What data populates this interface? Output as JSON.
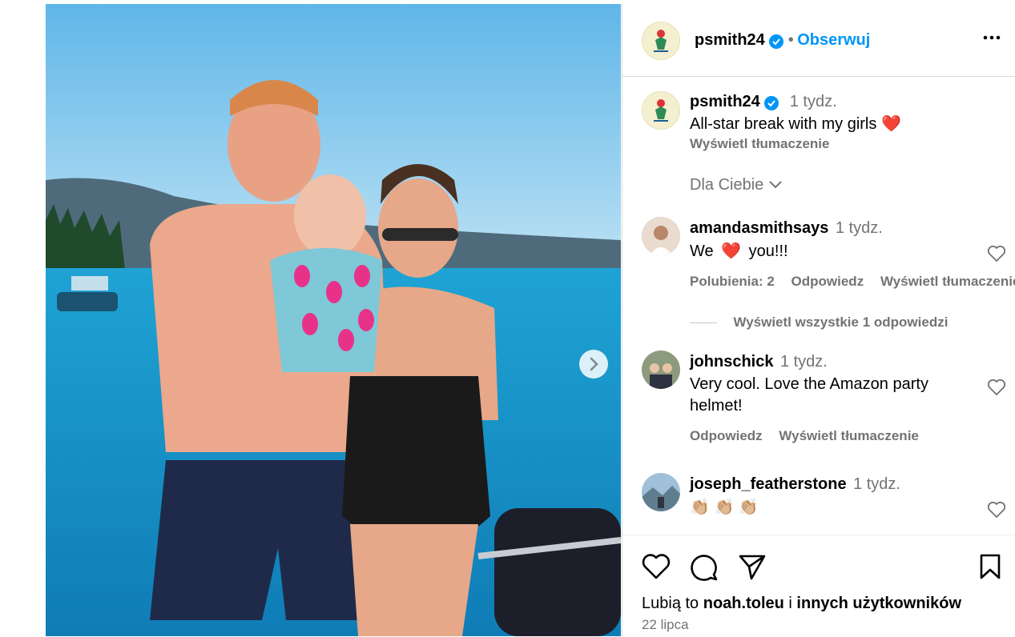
{
  "post": {
    "author": "psmith24",
    "follow_label": "Obserwuj",
    "separator": "•",
    "caption_time": "1 tydz.",
    "caption": "All-star break with my girls",
    "caption_emoji": "❤️",
    "translate_label": "Wyświetl tłumaczenie",
    "sort_label": "Dla Ciebie"
  },
  "comments": [
    {
      "user": "amandasmithsays",
      "time": "1 tydz.",
      "text_before": "We",
      "emoji": "❤️",
      "text_after": "you!!!",
      "likes_label": "Polubienia: 2",
      "reply_label": "Odpowiedz",
      "translate_label": "Wyświetl tłumaczenie",
      "view_replies": "Wyświetl wszystkie 1 odpowiedzi"
    },
    {
      "user": "johnschick",
      "time": "1 tydz.",
      "text": "Very cool. Love the Amazon party helmet!",
      "reply_label": "Odpowiedz",
      "translate_label": "Wyświetl tłumaczenie"
    },
    {
      "user": "joseph_featherstone",
      "time": "1 tydz.",
      "text": "👏🏼 👏🏼 👏🏼"
    }
  ],
  "footer": {
    "likes_prefix": "Lubią to",
    "liker": "noah.toleu",
    "likes_conj": "i",
    "likes_others": "innych użytkowników",
    "date": "22 lipca"
  },
  "colors": {
    "accent": "#0095f6",
    "secondary_text": "#737373",
    "border": "#dbdbdb"
  },
  "icons": [
    "verified-badge-icon",
    "more-options-icon",
    "chevron-down-icon",
    "heart-icon",
    "comment-icon",
    "share-icon",
    "bookmark-icon",
    "chevron-right-icon"
  ]
}
